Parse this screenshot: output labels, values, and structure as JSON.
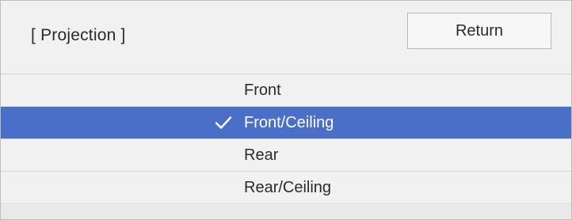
{
  "menu": {
    "title": "[ Projection ]",
    "return_label": "Return",
    "options": [
      {
        "label": "Front",
        "selected": false
      },
      {
        "label": "Front/Ceiling",
        "selected": true
      },
      {
        "label": "Rear",
        "selected": false
      },
      {
        "label": "Rear/Ceiling",
        "selected": false
      }
    ]
  },
  "colors": {
    "selection": "#4a6fc8",
    "background": "#f1f1f1",
    "text": "#2b2b2b"
  },
  "icons": {
    "selected_marker": "check-icon"
  }
}
